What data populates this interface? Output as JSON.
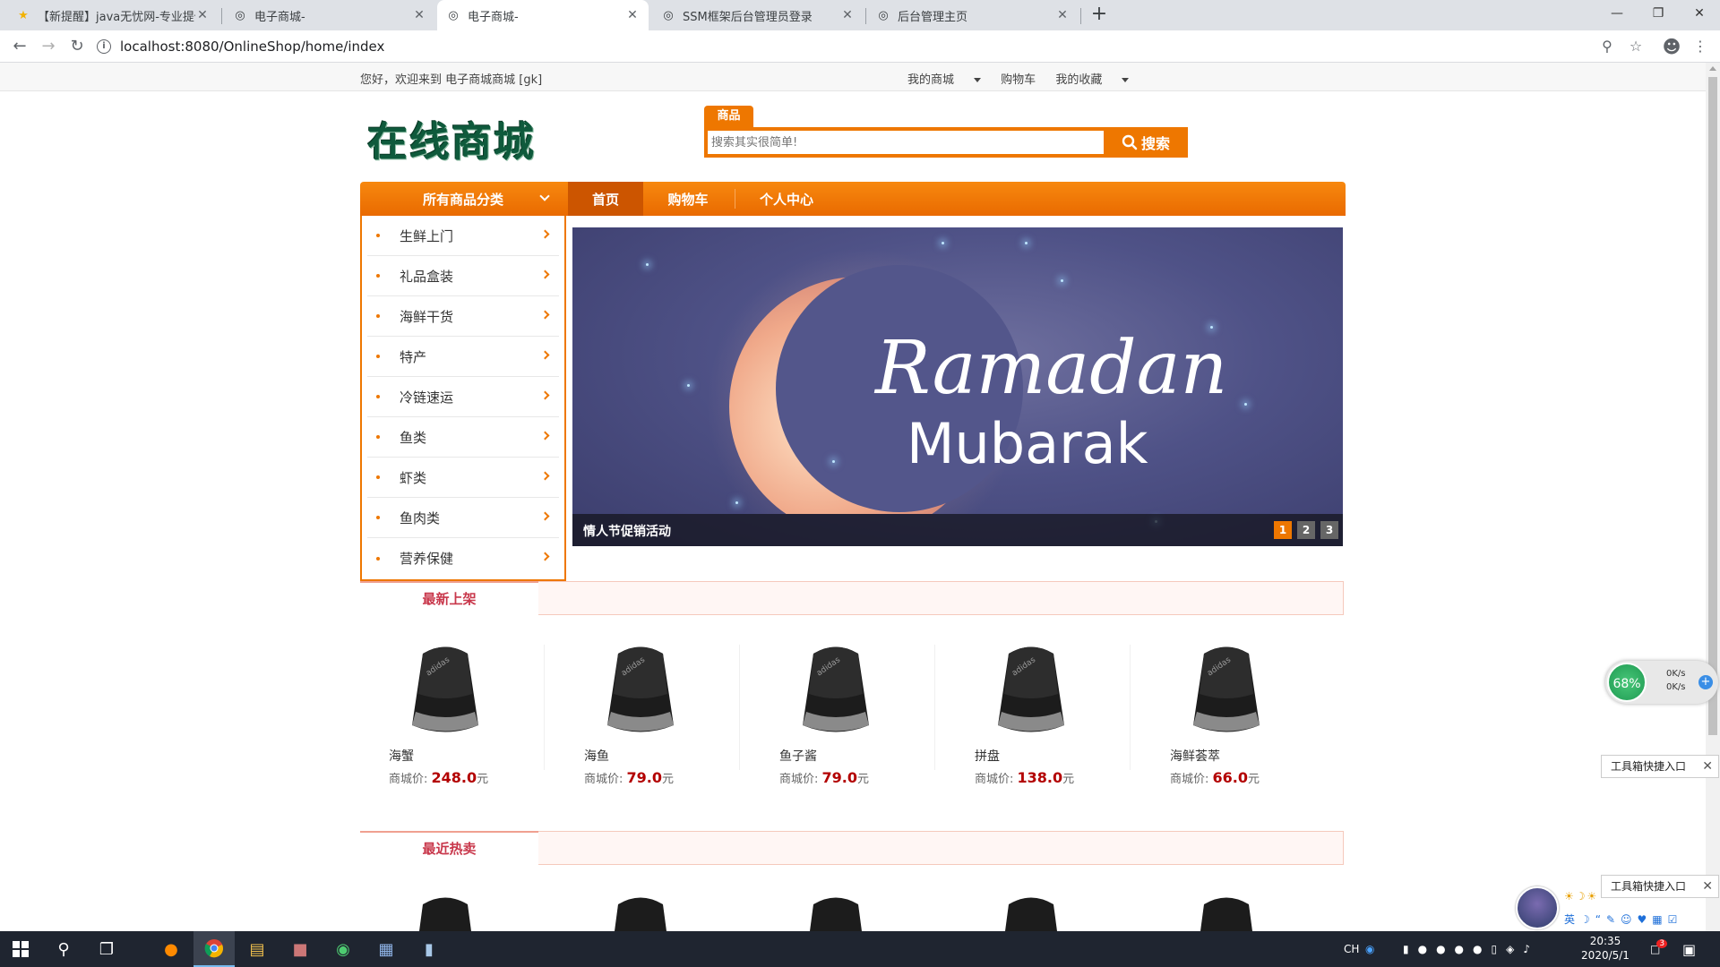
{
  "browser": {
    "tabs": [
      {
        "title": "【新提醒】java无忧网-专业提供",
        "favicon": "bell-icon"
      },
      {
        "title": "电子商城-",
        "favicon": "globe-icon"
      },
      {
        "title": "电子商城-",
        "favicon": "globe-icon",
        "active": true
      },
      {
        "title": "SSM框架后台管理员登录",
        "favicon": "globe-icon"
      },
      {
        "title": "后台管理主页",
        "favicon": "globe-icon"
      }
    ],
    "url": "localhost:8080/OnlineShop/home/index"
  },
  "topbar": {
    "welcome": "您好，欢迎来到 电子商城商城 [gk]",
    "links": [
      "我的商城",
      "购物车",
      "我的收藏"
    ]
  },
  "header": {
    "logo": "在线商城",
    "search_tab": "商品",
    "search_placeholder": "搜索其实很简单!",
    "search_button": "搜索"
  },
  "nav": {
    "all_categories": "所有商品分类",
    "items": [
      "首页",
      "购物车",
      "个人中心"
    ]
  },
  "categories": [
    "生鲜上门",
    "礼品盒装",
    "海鲜干货",
    "特产",
    "冷链速运",
    "鱼类",
    "虾类",
    "鱼肉类",
    "营养保健"
  ],
  "banner": {
    "line1": "Ramadan",
    "line2": "Mubarak",
    "caption": "情人节促销活动",
    "pages": [
      "1",
      "2",
      "3"
    ]
  },
  "sections": {
    "newest": "最新上架",
    "hot": "最近热卖"
  },
  "products": [
    {
      "name": "海蟹",
      "price_label": "商城价:",
      "price": "248.0",
      "unit": "元"
    },
    {
      "name": "海鱼",
      "price_label": "商城价:",
      "price": "79.0",
      "unit": "元"
    },
    {
      "name": "鱼子酱",
      "price_label": "商城价:",
      "price": "79.0",
      "unit": "元"
    },
    {
      "name": "拼盘",
      "price_label": "商城价:",
      "price": "138.0",
      "unit": "元"
    },
    {
      "name": "海鲜荟萃",
      "price_label": "商城价:",
      "price": "66.0",
      "unit": "元"
    }
  ],
  "widgets": {
    "speed_percent": "68%",
    "upload": "0K/s",
    "download": "0K/s",
    "toolbox_label": "工具箱快捷入口"
  },
  "taskbar": {
    "time": "20:35",
    "date": "2020/5/1",
    "ime": "CH",
    "notification_count": "3"
  },
  "colors": {
    "accent": "#ee7700",
    "section_title": "#c8374b",
    "price": "#b30000"
  }
}
